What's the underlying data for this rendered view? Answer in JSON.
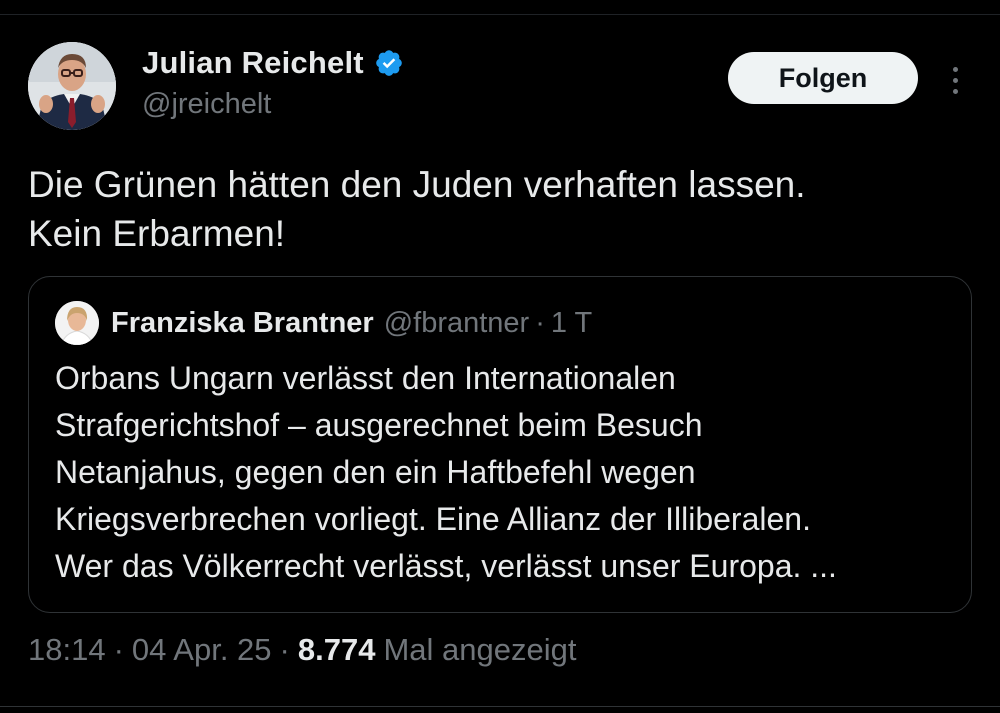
{
  "author": {
    "display_name": "Julian Reichelt",
    "handle": "@jreichelt",
    "verified": true
  },
  "follow_label": "Folgen",
  "more_icon": "more-vertical-icon",
  "tweet": {
    "line1": "Die Grünen hätten den Juden verhaften lassen.",
    "line2": "Kein Erbarmen!"
  },
  "quoted": {
    "display_name": "Franziska Brantner",
    "handle": "@fbrantner",
    "separator": "·",
    "time": "1 T",
    "lines": [
      "Orbans Ungarn verlässt den Internationalen",
      "Strafgerichtshof – ausgerechnet beim Besuch",
      "Netanjahus, gegen den ein Haftbefehl wegen",
      "Kriegsverbrechen vorliegt. Eine Allianz der Illiberalen.",
      "Wer das Völkerrecht verlässt, verlässt unser Europa. ..."
    ]
  },
  "meta": {
    "time": "18:14",
    "separator": "·",
    "date": "04 Apr. 25",
    "views_count": "8.774",
    "views_label": "Mal angezeigt"
  },
  "colors": {
    "background": "#000000",
    "text": "#e7e9ea",
    "secondary": "#71767b",
    "border": "#2f3336",
    "verified": "#1d9bf0",
    "button_bg": "#eff3f4"
  }
}
